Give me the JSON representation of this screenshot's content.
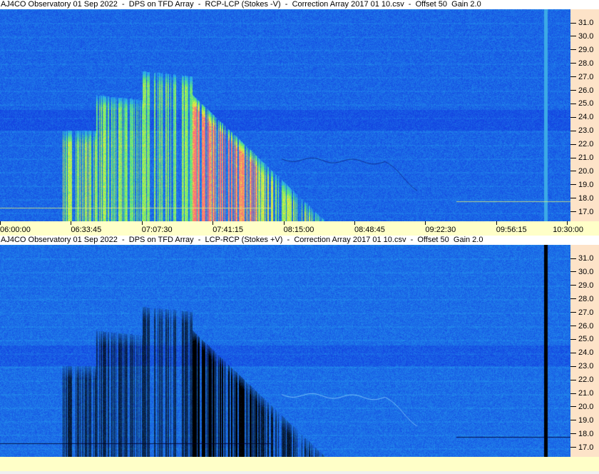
{
  "panels": [
    {
      "title": "AJ4CO Observatory 01 Sep 2022  -  DPS on TFD Array  -  RCP-LCP (Stokes -V)  -  Correction Array 2017 01 10.csv  -  Offset 50  Gain 2.0",
      "mode": "positive"
    },
    {
      "title": "AJ4CO Observatory 01 Sep 2022  -  DPS on TFD Array  -  LCP-RCP (Stokes +V)  -  Correction Array 2017 01 10.csv  -  Offset 50  Gain 2.0",
      "mode": "negative"
    }
  ],
  "freq_ticks": [
    "31.0",
    "30.0",
    "29.0",
    "28.0",
    "27.0",
    "26.0",
    "25.0",
    "24.0",
    "23.0",
    "22.0",
    "21.0",
    "20.0",
    "19.0",
    "18.0",
    "17.0"
  ],
  "time_ticks": [
    "06:00:00",
    "06:33:45",
    "07:07:30",
    "07:41:15",
    "08:15:00",
    "08:48:45",
    "09:22:30",
    "09:56:15",
    "10:30:00"
  ],
  "colors": {
    "axis_bg": "#fde3c8",
    "time_bg": "#ffffc8"
  }
}
